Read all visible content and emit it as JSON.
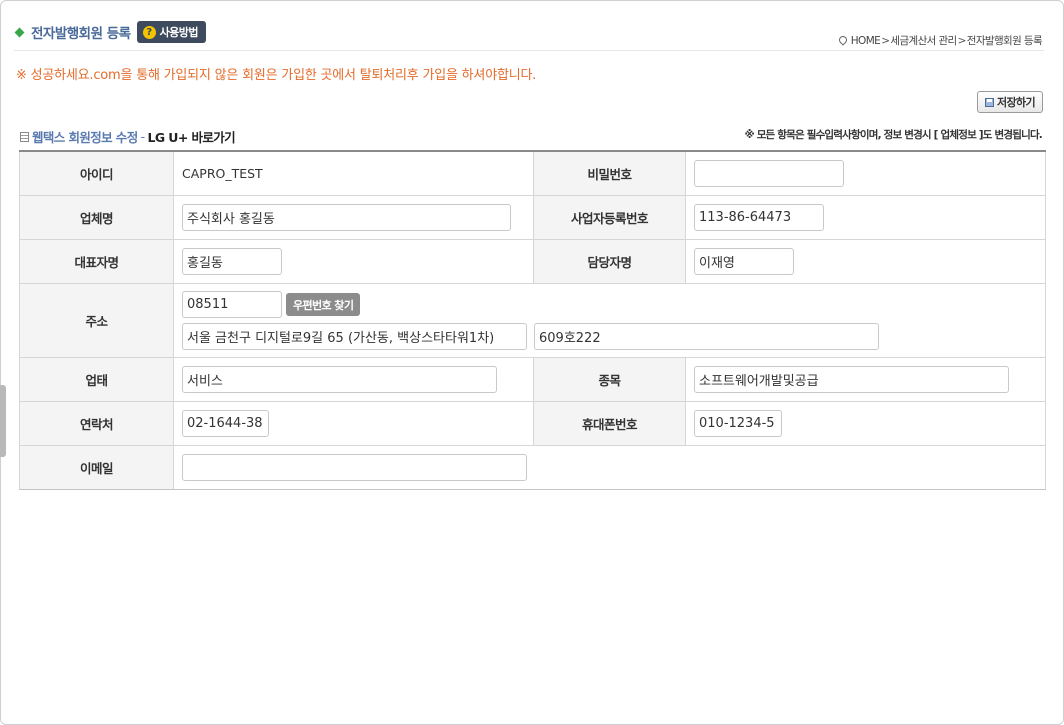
{
  "header": {
    "title": "전자발행회원 등록",
    "howto_label": "사용방법",
    "howto_icon": "?",
    "breadcrumb": [
      "HOME",
      "세금계산서 관리",
      "전자발행회원 등록"
    ],
    "breadcrumb_sep": ">"
  },
  "notice": "※ 성공하세요.com을 통해 가입되지 않은 회원은 가입한 곳에서 탈퇴처리후 가입을 하셔야합니다.",
  "toolbar": {
    "save_label": "저장하기"
  },
  "section": {
    "title": "웹택스 회원정보 수정",
    "dash": "-",
    "link": "LG U+ 바로가기",
    "note": "※ 모든 항목은 필수입력사항이며, 정보 변경시 [ 업체정보 ]도 변경됩니다."
  },
  "form": {
    "id": {
      "label": "아이디",
      "value": "CAPRO_TEST"
    },
    "password": {
      "label": "비밀번호",
      "value": ""
    },
    "company": {
      "label": "업체명",
      "value": "주식회사 홍길동"
    },
    "bizno": {
      "label": "사업자등록번호",
      "value": "113-86-64473"
    },
    "ceo": {
      "label": "대표자명",
      "value": "홍길동"
    },
    "manager": {
      "label": "담당자명",
      "value": "이재영"
    },
    "address": {
      "label": "주소",
      "zip": "08511",
      "zip_button": "우편번호 찾기",
      "addr1": "서울 금천구 디지털로9길 65 (가산동, 백상스타타워1차)",
      "addr2": "609호222"
    },
    "biztype": {
      "label": "업태",
      "value": "서비스"
    },
    "bizitem": {
      "label": "종목",
      "value": "소프트웨어개발및공급"
    },
    "phone": {
      "label": "연락처",
      "value": "02-1644-38"
    },
    "mobile": {
      "label": "휴대폰번호",
      "value": "010-1234-5"
    },
    "email": {
      "label": "이메일",
      "value": ""
    }
  }
}
